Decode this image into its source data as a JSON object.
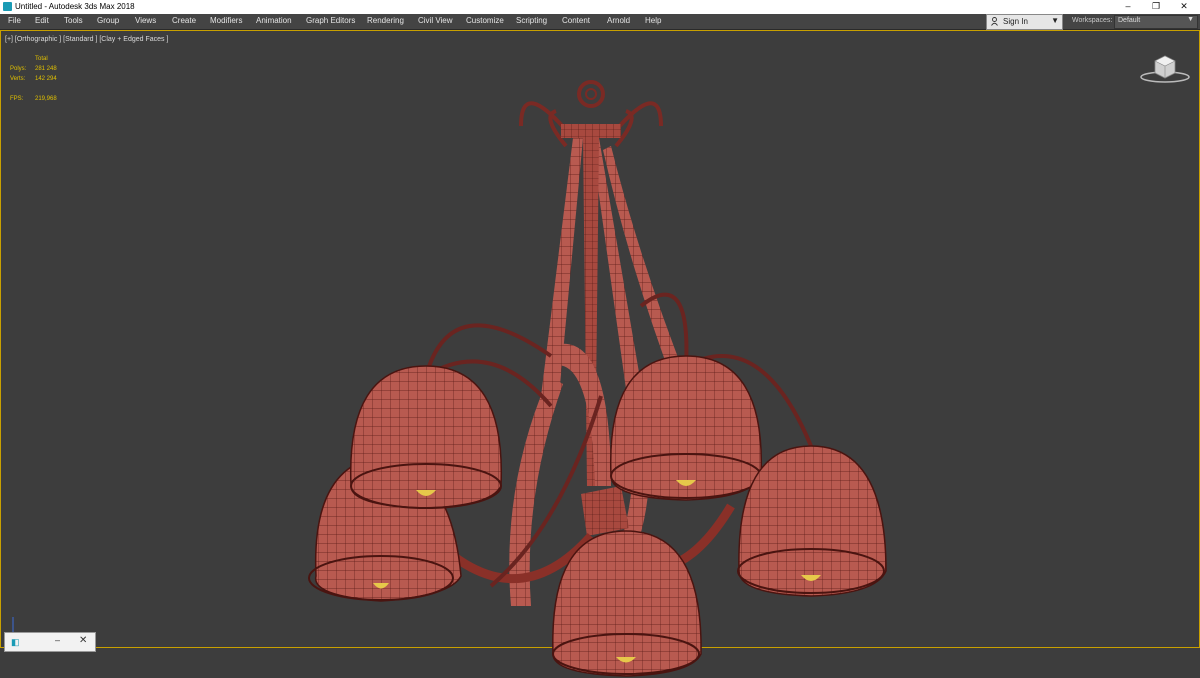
{
  "window": {
    "title": "Untitled - Autodesk 3ds Max 2018",
    "controls": {
      "minimize": "–",
      "restore": "❐",
      "close": "✕"
    }
  },
  "menubar": {
    "items": [
      "File",
      "Edit",
      "Tools",
      "Group",
      "Views",
      "Create",
      "Modifiers",
      "Animation",
      "Graph Editors",
      "Rendering",
      "Civil View",
      "Customize",
      "Scripting",
      "Content",
      "Arnold",
      "Help"
    ]
  },
  "account": {
    "signin_label": "Sign In",
    "icon": "user-icon"
  },
  "workspaces": {
    "label": "Workspaces:",
    "value": "Default"
  },
  "viewport": {
    "label": "[+] [Orthographic ] [Standard ] [Clay + Edged Faces ]",
    "stats": {
      "header": "Total",
      "polys_label": "Polys:",
      "polys_value": "281 248",
      "verts_label": "Verts:",
      "verts_value": "142 294",
      "fps_label": "FPS:",
      "fps_value": "219,968"
    },
    "border_color": "#c8a000",
    "background": "#3d3d3d"
  },
  "scene": {
    "object": "chandelier-model",
    "shade_color": "#b85a50",
    "wire_color": "#5a1a16"
  },
  "statusbar": {
    "minimize": "–",
    "close": "✕"
  }
}
